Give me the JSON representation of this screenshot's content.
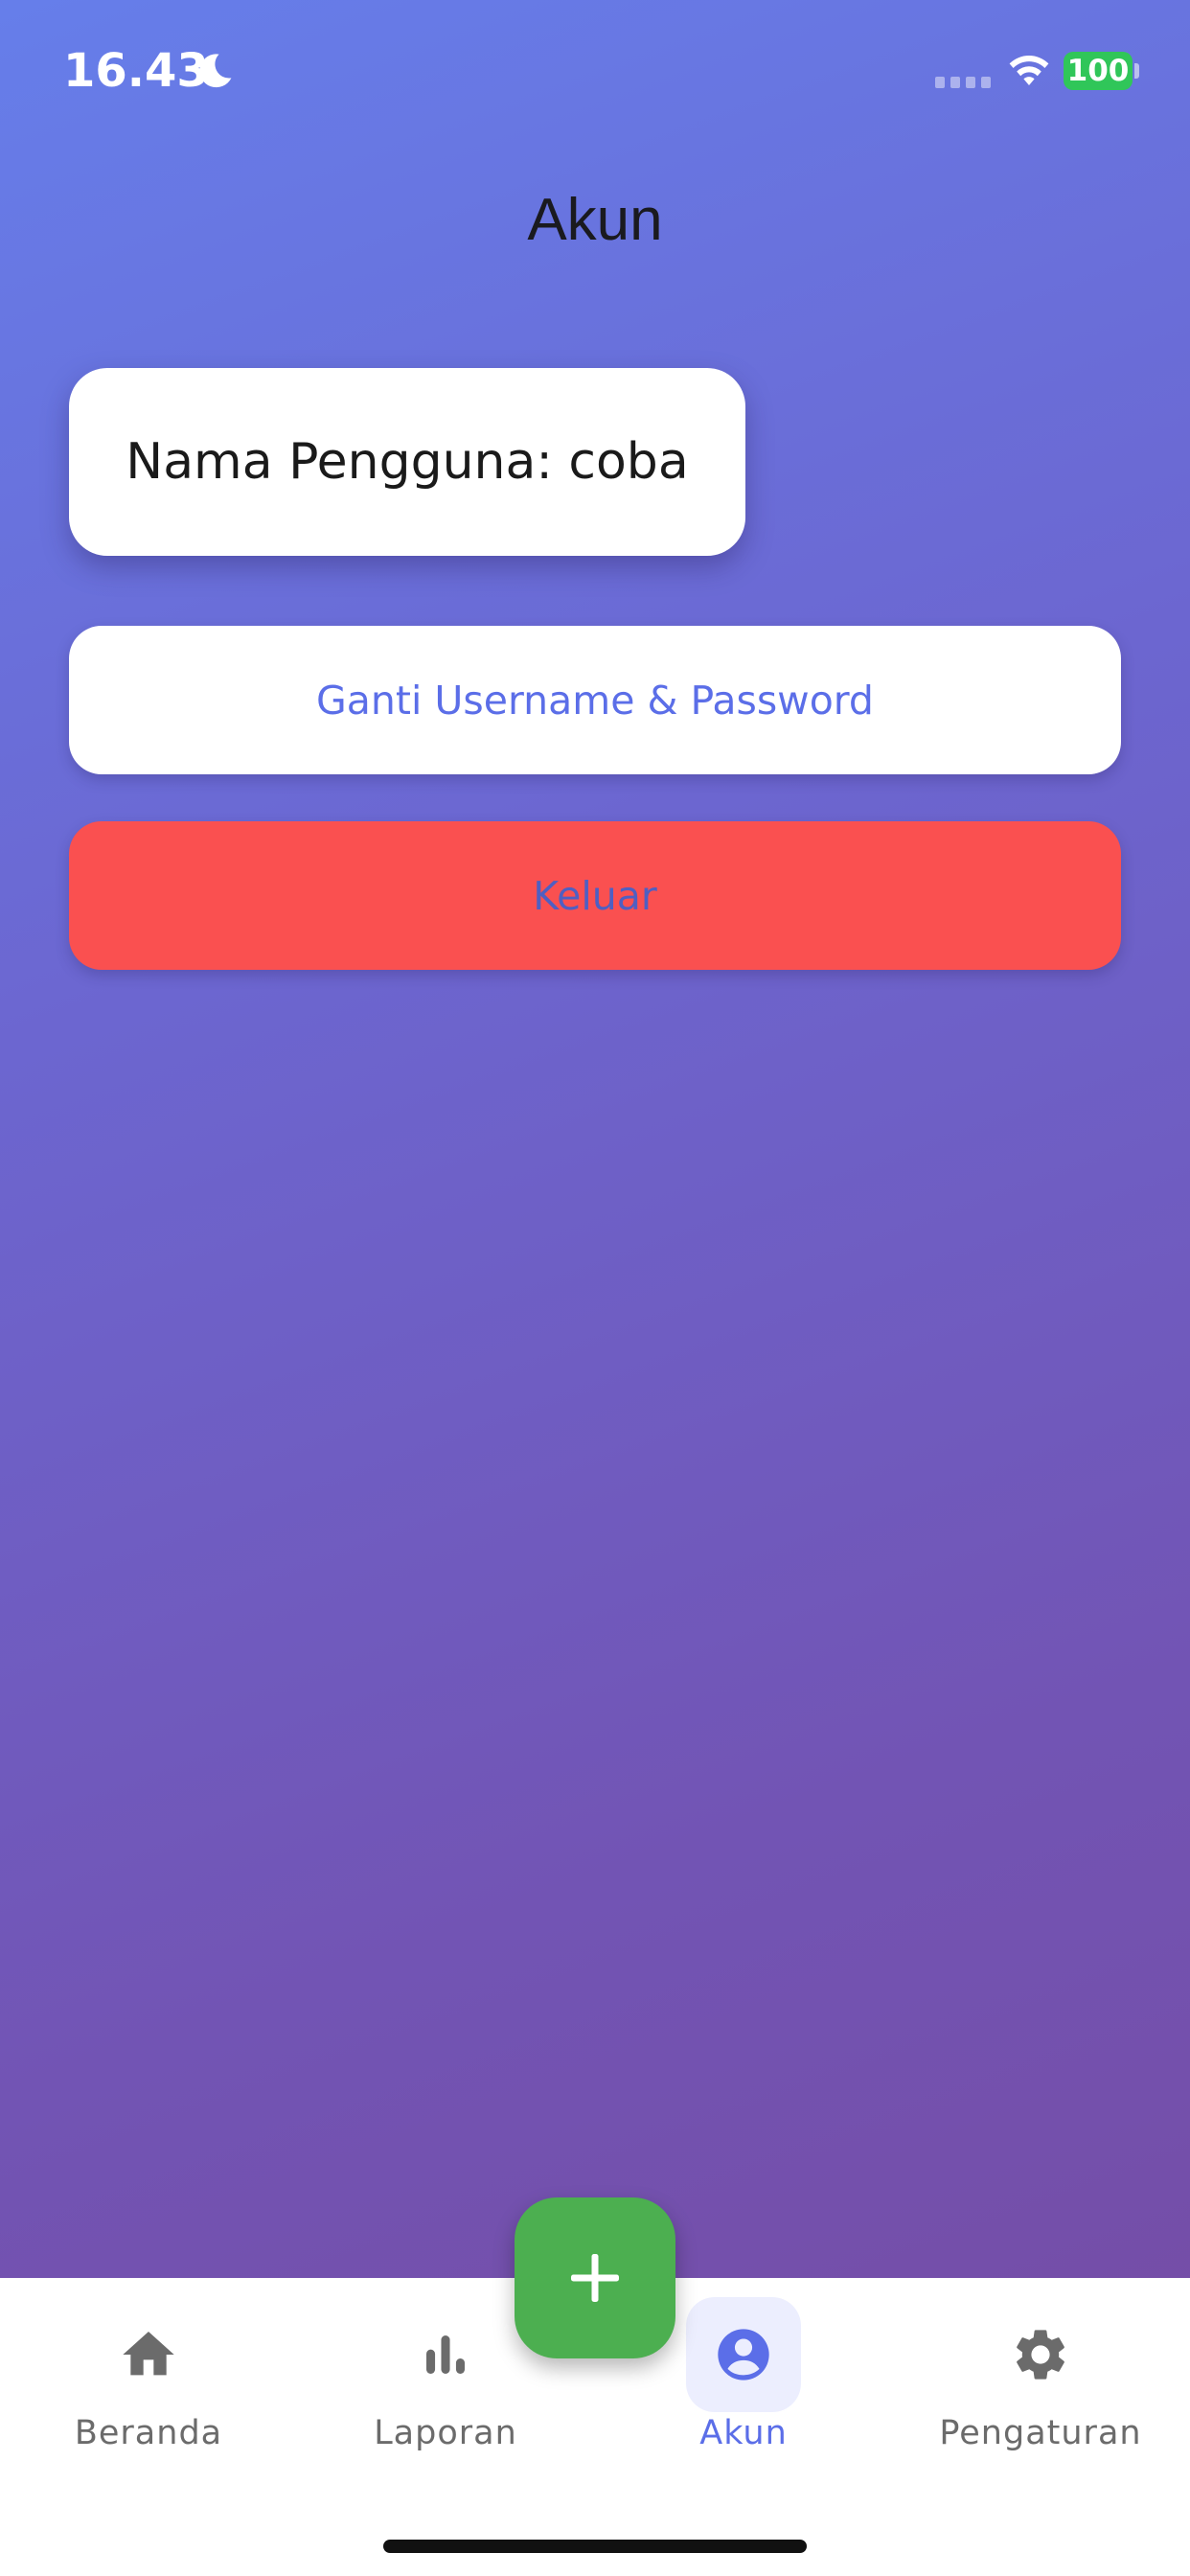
{
  "status_bar": {
    "time": "16.43",
    "battery": "100",
    "icons": [
      "moon-icon",
      "signal-icon",
      "wifi-icon",
      "battery-icon"
    ]
  },
  "page": {
    "title": "Akun"
  },
  "user_card": {
    "text": "Nama Pengguna: coba"
  },
  "buttons": {
    "change_credentials": "Ganti Username & Password",
    "logout": "Keluar"
  },
  "fab": {
    "icon": "plus-icon"
  },
  "bottom_nav": {
    "active": "Akun",
    "items": [
      {
        "label": "Beranda",
        "icon": "home-icon"
      },
      {
        "label": "Laporan",
        "icon": "bar-chart-icon"
      },
      {
        "label": "Akun",
        "icon": "account-circle-icon"
      },
      {
        "label": "Pengaturan",
        "icon": "gear-icon"
      }
    ]
  },
  "colors": {
    "gradient_start": "#667eea",
    "gradient_end": "#764ba2",
    "accent": "#5b6ee8",
    "logout_red": "#fa5050",
    "fab_green": "#4caf50",
    "battery_green": "#30c659"
  }
}
